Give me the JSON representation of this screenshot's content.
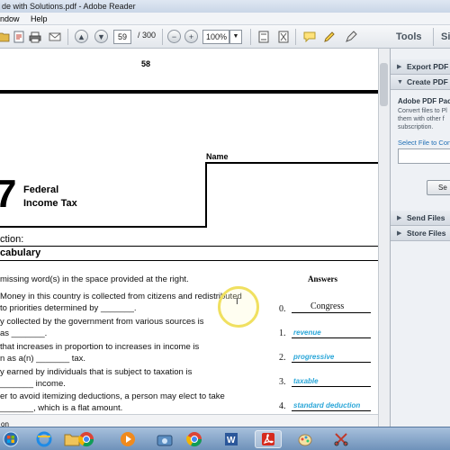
{
  "window": {
    "title": "de with Solutions.pdf - Adobe Reader"
  },
  "menu": {
    "items": [
      "ndow",
      "Help"
    ]
  },
  "toolbar": {
    "page_current": "59",
    "page_total": "/ 300",
    "zoom": "100%",
    "tools_label": "Tools",
    "sign_label": "Si"
  },
  "document": {
    "page_number": "58",
    "chapter_digit": "7",
    "chapter_title_line1": "Federal",
    "chapter_title_line2": "Income Tax",
    "name_label": "Name",
    "section_label": "ction:",
    "section_title": "cabulary",
    "instruction": "missing word(s) in the space provided at the right.",
    "answers_header": "Answers",
    "questions": [
      {
        "line1": "Money in this country is collected from citizens and redistributed",
        "line2": "to priorities determined by _______."
      },
      {
        "line1": "y collected by the government from various sources is",
        "line2": "as _______."
      },
      {
        "line1": "that increases in proportion to increases in income is",
        "line2": "n as a(n) _______ tax."
      },
      {
        "line1": "y earned by individuals that is subject to taxation is",
        "line2": "_______ income."
      },
      {
        "line1": "er to avoid itemizing deductions, a person may elect to take",
        "line2": "_______, which is a flat amount."
      }
    ],
    "answers": [
      {
        "num": "0.",
        "text": "Congress"
      },
      {
        "num": "1.",
        "text": "revenue"
      },
      {
        "num": "2.",
        "text": "progressive"
      },
      {
        "num": "3.",
        "text": "taxable"
      },
      {
        "num": "4.",
        "text": "standard deduction"
      }
    ],
    "bottom_cut": "on"
  },
  "panel": {
    "export_label": "Export PDF",
    "create_label": "Create PDF",
    "pack_title": "Adobe PDF Pack",
    "pack_desc1": "Convert files to Pl",
    "pack_desc2": "them with other f",
    "pack_desc3": "subscription.",
    "select_link": "Select File to Con",
    "select_button": "Se",
    "send_label": "Send Files",
    "store_label": "Store Files"
  },
  "colors": {
    "answer_blue": "#2aa6d8",
    "cursor_ring": "#f0e060"
  }
}
